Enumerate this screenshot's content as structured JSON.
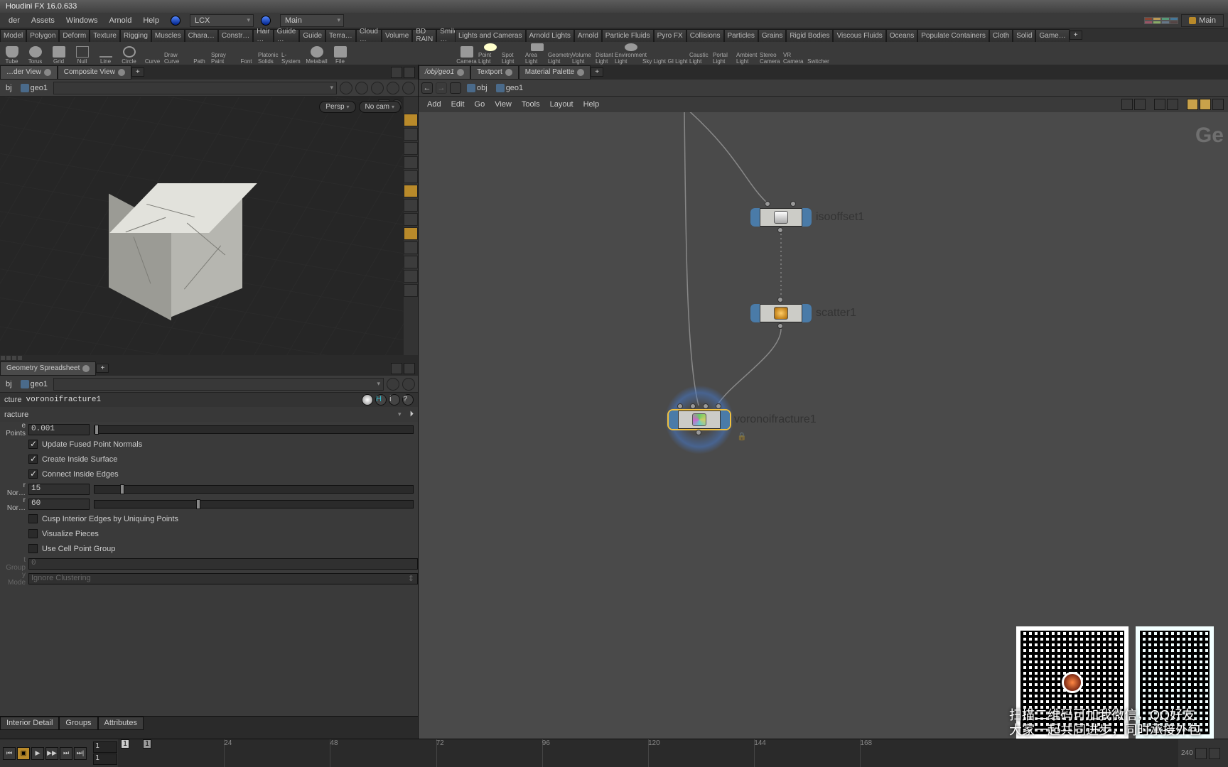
{
  "app_title": "Houdini FX 16.0.633",
  "main_menu": [
    "der",
    "Assets",
    "Windows",
    "Arnold",
    "Help"
  ],
  "context_combos": {
    "left": "LCX",
    "right": "Main"
  },
  "desktop_label": "Main",
  "shelf_tabs_left": [
    "Model",
    "Polygon",
    "Deform",
    "Texture",
    "Rigging",
    "Muscles",
    "Chara…",
    "Constr…",
    "Hair …",
    "Guide …",
    "Guide",
    "Terra…",
    "Cloud …",
    "Volume",
    "BD RAIN",
    "Smile …"
  ],
  "shelf_tabs_right": [
    "Lights and Cameras",
    "Arnold Lights",
    "Arnold",
    "Particle Fluids",
    "Pyro FX",
    "Collisions",
    "Particles",
    "Grains",
    "Rigid Bodies",
    "Viscous Fluids",
    "Oceans",
    "Populate Containers",
    "Cloth",
    "Solid",
    "Game…"
  ],
  "tools_left": [
    "Tube",
    "Torus",
    "Grid",
    "Null",
    "Line",
    "Circle",
    "Curve",
    "Draw Curve",
    "Path",
    "Spray Paint",
    "Font",
    "Platonic Solids",
    "L-System",
    "Metaball",
    "File"
  ],
  "tools_right": [
    "Camera",
    "Point Light",
    "Spot Light",
    "Area Light",
    "Geometry Light",
    "Volume Light",
    "Distant Light",
    "Environment Light",
    "Sky Light",
    "GI Light",
    "Caustic Light",
    "Portal Light",
    "Ambient Light",
    "Stereo Camera",
    "VR Camera",
    "Switcher"
  ],
  "left_pane_tabs": [
    "…der View",
    "Composite View"
  ],
  "param_pane_tabs": [
    "Geometry Spreadsheet"
  ],
  "scene_crumb": {
    "obj": "bj",
    "node": "geo1"
  },
  "viewport": {
    "persp_label": "Persp",
    "cam_label": "No cam"
  },
  "param": {
    "type_label": "cture",
    "node_name": "voronoifracture1",
    "section_label": "racture",
    "rows": {
      "fuse_points_label": "e Points",
      "fuse_points_value": "0.001",
      "chk1": "Update Fused Point Normals",
      "chk2": "Create Inside Surface",
      "chk3": "Connect Inside Edges",
      "nor1_label": "r Nor…",
      "nor1_value": "15",
      "nor2_label": "r Nor…",
      "nor2_value": "60",
      "chk4": "Cusp Interior Edges by Uniquing Points",
      "chk5": "Visualize Pieces",
      "chk6": "Use Cell Point Group",
      "group_label": "t Group",
      "group_value": "0",
      "mode_label": "y Mode",
      "mode_value": "Ignore Clustering"
    },
    "bottom_tabs": [
      "Interior Detail",
      "Groups",
      "Attributes"
    ]
  },
  "network": {
    "path_crumb_full": "/obj/geo1",
    "path_obj": "obj",
    "path_node": "geo1",
    "tabs_extra": [
      "Textport",
      "Material Palette"
    ],
    "menu": [
      "Add",
      "Edit",
      "Go",
      "View",
      "Tools",
      "Layout",
      "Help"
    ],
    "watermark": "Ge",
    "nodes": {
      "iso": "isooffset1",
      "scatter": "scatter1",
      "voronoi": "voronoifracture1"
    }
  },
  "timeline": {
    "start": "1",
    "end": "1",
    "current": "1",
    "last": "240",
    "ticks": [
      "24",
      "48",
      "72",
      "96",
      "120",
      "144",
      "168"
    ]
  },
  "qr_caption_line1": "扫描二维码可加我微信，QQ好友",
  "qr_caption_line2": "大家一起共同进步，同时承接外包"
}
